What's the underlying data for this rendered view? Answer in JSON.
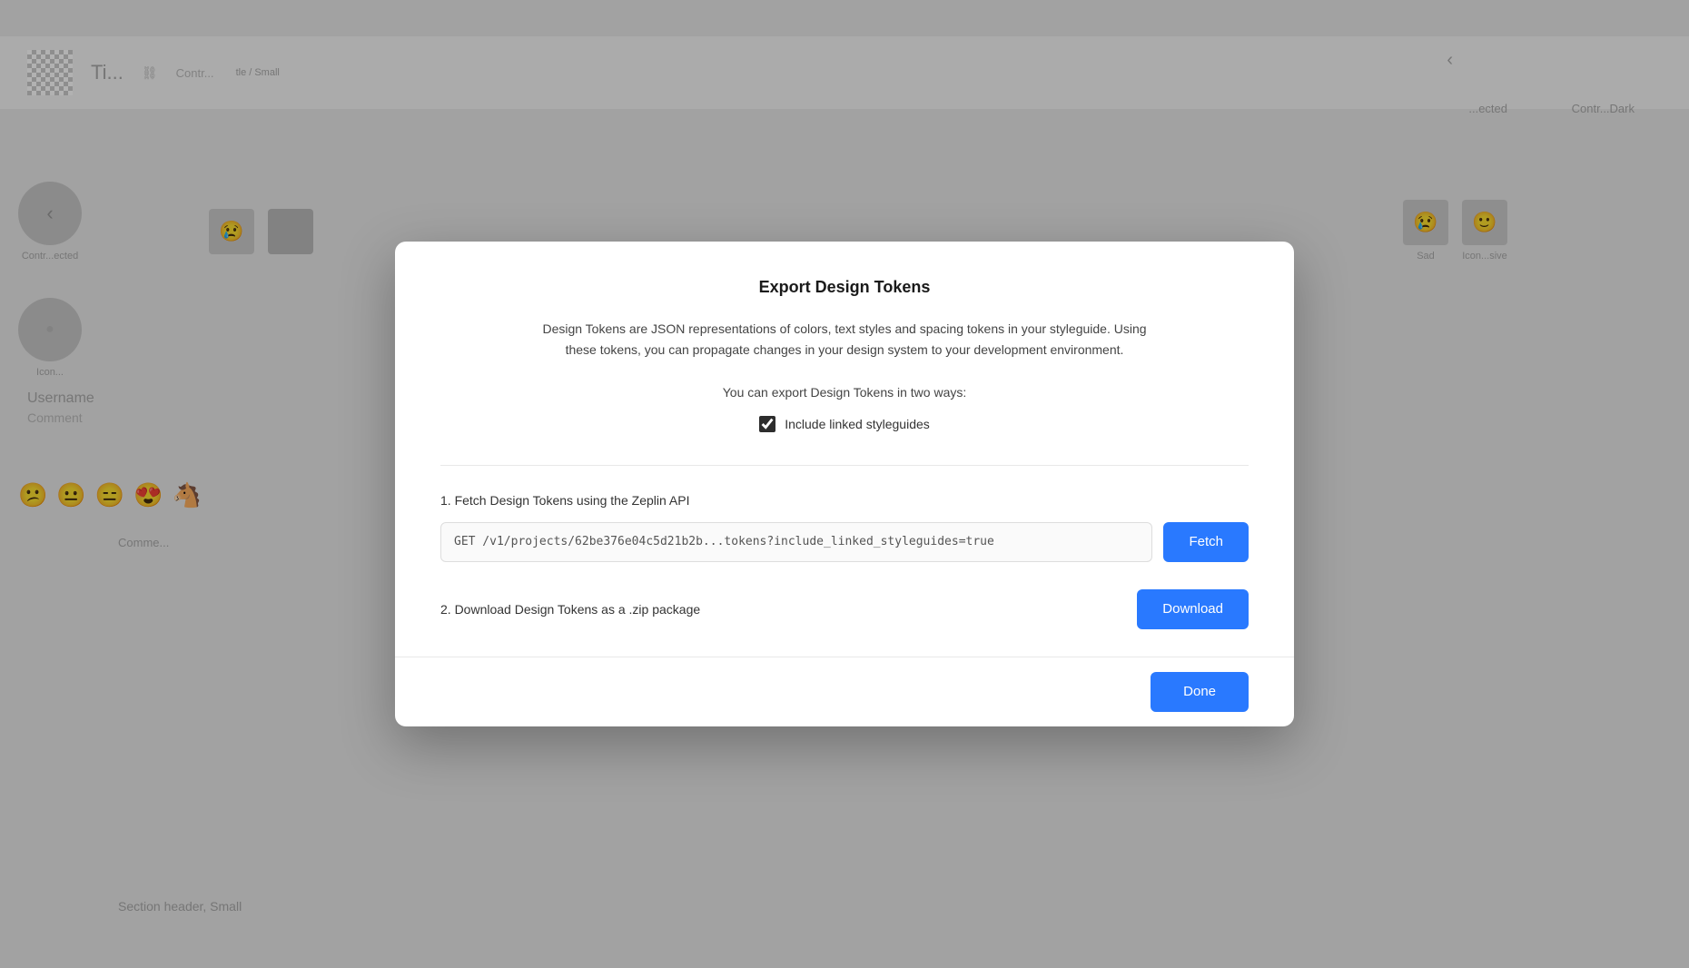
{
  "background": {
    "title": "Ti...",
    "breadcrumb": "tle / Small",
    "link_label": "Contr...",
    "right_arrow_label": "<",
    "right_label1": "...ected",
    "right_label2": "Contr...Dark",
    "left_nav": {
      "back_label": "Contr...ected",
      "icon_label": "Icon..."
    },
    "right_nav_label1": "Sad",
    "right_nav_label2": "Icon...sive",
    "username": "Username",
    "comment": "Comment",
    "emojis": [
      "😕",
      "😐",
      "😑",
      "😍",
      "🐴"
    ],
    "comments_label": "Comme...",
    "section_header": "Section header, Small"
  },
  "modal": {
    "title": "Export Design Tokens",
    "description": "Design Tokens are JSON representations of colors, text styles and spacing tokens in your styleguide. Using these tokens, you can propagate changes in your design system to your development environment.",
    "ways_text": "You can export Design Tokens in two ways:",
    "checkbox": {
      "label": "Include linked styleguides",
      "checked": true
    },
    "section1": {
      "heading": "1. Fetch Design Tokens using the Zeplin API",
      "api_url": "GET /v1/projects/62be376e04c5d21b2b...tokens?include_linked_styleguides=true",
      "fetch_button": "Fetch"
    },
    "section2": {
      "heading": "2. Download Design Tokens as a .zip package",
      "download_button": "Download"
    },
    "footer": {
      "done_button": "Done"
    }
  }
}
